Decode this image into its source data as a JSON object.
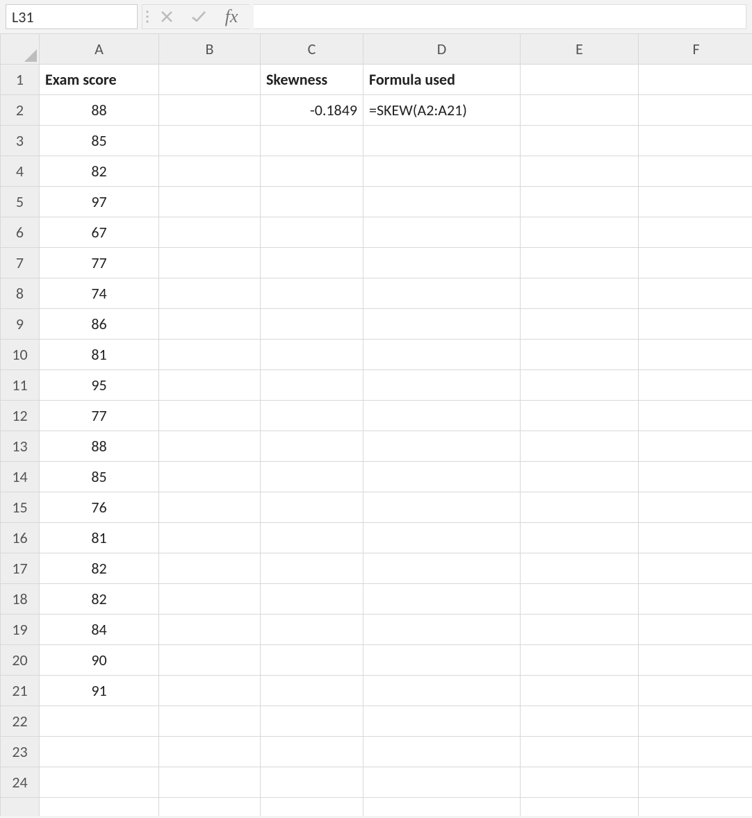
{
  "formula_bar": {
    "name_box": "L31",
    "fx_label": "fx",
    "formula_value": ""
  },
  "columns": [
    "A",
    "B",
    "C",
    "D",
    "E",
    "F"
  ],
  "row_count": 24,
  "headers": {
    "A1": "Exam score",
    "C1": "Skewness",
    "D1": "Formula used"
  },
  "skewness_value": "-0.1849",
  "formula_used": "=SKEW(A2:A21)",
  "exam_scores": [
    88,
    85,
    82,
    97,
    67,
    77,
    74,
    86,
    81,
    95,
    77,
    88,
    85,
    76,
    81,
    82,
    82,
    84,
    90,
    91
  ]
}
